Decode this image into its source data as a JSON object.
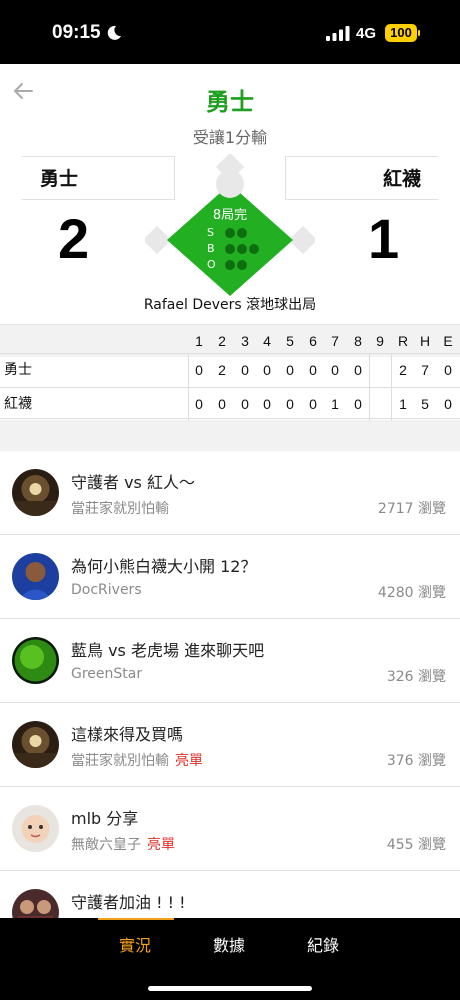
{
  "status_bar": {
    "time": "09:15",
    "network": "4G",
    "battery": "100"
  },
  "game": {
    "title": "勇士",
    "handicap": "受讓1分輸",
    "home_team": "勇士",
    "away_team": "紅襪",
    "home_score": "2",
    "away_score": "1",
    "inning": "8局完",
    "count_labels": {
      "strikes": "S",
      "balls": "B",
      "outs": "O"
    },
    "last_play": "Rafael Devers 滾地球出局"
  },
  "linescore": {
    "columns": [
      "1",
      "2",
      "3",
      "4",
      "5",
      "6",
      "7",
      "8",
      "9",
      "R",
      "H",
      "E"
    ],
    "rows": [
      {
        "team": "勇士",
        "cells": [
          "0",
          "2",
          "0",
          "0",
          "0",
          "0",
          "0",
          "0",
          "",
          "2",
          "7",
          "0"
        ]
      },
      {
        "team": "紅襪",
        "cells": [
          "0",
          "0",
          "0",
          "0",
          "0",
          "0",
          "1",
          "0",
          "",
          "1",
          "5",
          "0"
        ]
      }
    ]
  },
  "posts": [
    {
      "title": "守護者 vs 紅人～",
      "author": "當莊家就別怕輸",
      "tag": "",
      "views": "2717 瀏覽",
      "avatar_icon": "stadium-avatar-icon"
    },
    {
      "title": "為何小熊白襪大小開 12？",
      "author": "DocRivers",
      "tag": "",
      "views": "4280 瀏覽",
      "avatar_icon": "person-avatar-icon"
    },
    {
      "title": "藍鳥 vs 老虎場  進來聊天吧",
      "author": "GreenStar",
      "tag": "",
      "views": "326 瀏覽",
      "avatar_icon": "green-sun-avatar-icon"
    },
    {
      "title": "這樣來得及買嗎",
      "author": "當莊家就別怕輸",
      "tag": "亮單",
      "views": "376 瀏覽",
      "avatar_icon": "stadium-avatar-icon"
    },
    {
      "title": "mlb 分享",
      "author": "無敵六皇子",
      "tag": "亮單",
      "views": "455 瀏覽",
      "avatar_icon": "baby-avatar-icon"
    },
    {
      "title": "守護者加油 ! ! !",
      "author": "",
      "tag": "",
      "views": "",
      "avatar_icon": "people-avatar-icon"
    }
  ],
  "tabs": [
    {
      "label": "實況",
      "active": true
    },
    {
      "label": "數據",
      "active": false
    },
    {
      "label": "紀錄",
      "active": false
    }
  ],
  "colors": {
    "accent_green": "#1ea01e",
    "tab_active": "#f0a018",
    "hot_tag": "#e0302a"
  }
}
